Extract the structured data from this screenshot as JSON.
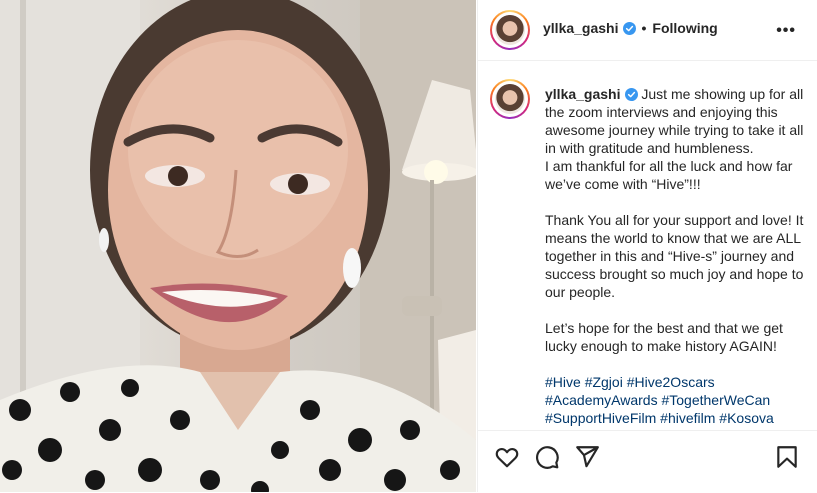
{
  "post": {
    "username": "yllka_gashi",
    "follow_status": "Following",
    "separator": "•",
    "more_label": "•••"
  },
  "caption": {
    "username": "yllka_gashi",
    "paragraphs": [
      "Just me showing up for all the zoom interviews and enjoying this awesome journey while trying to take it all in with gratitude and humbleness.\nI am thankful for all the luck and how far we’ve come with “Hive”!!!",
      "Thank You all for your support and love! It means the world to know that we are ALL together in this and “Hive-s” journey and success brought so much joy and hope to our people.",
      "Let’s hope for the best and that we get lucky enough to make history AGAIN!"
    ],
    "hashtags": [
      "#Hive",
      "#Zgjoi",
      "#Hive2Oscars",
      "#AcademyAwards",
      "#TogetherWeCan",
      "#SupportHiveFilm",
      "#hivefilm",
      "#Kosova"
    ]
  },
  "actions": {
    "icons": [
      "heart-icon",
      "comment-icon",
      "share-icon",
      "bookmark-icon"
    ]
  },
  "colors": {
    "verified": "#3897f0",
    "hashtag": "#00376b",
    "text": "#262626",
    "border": "#efefef"
  }
}
